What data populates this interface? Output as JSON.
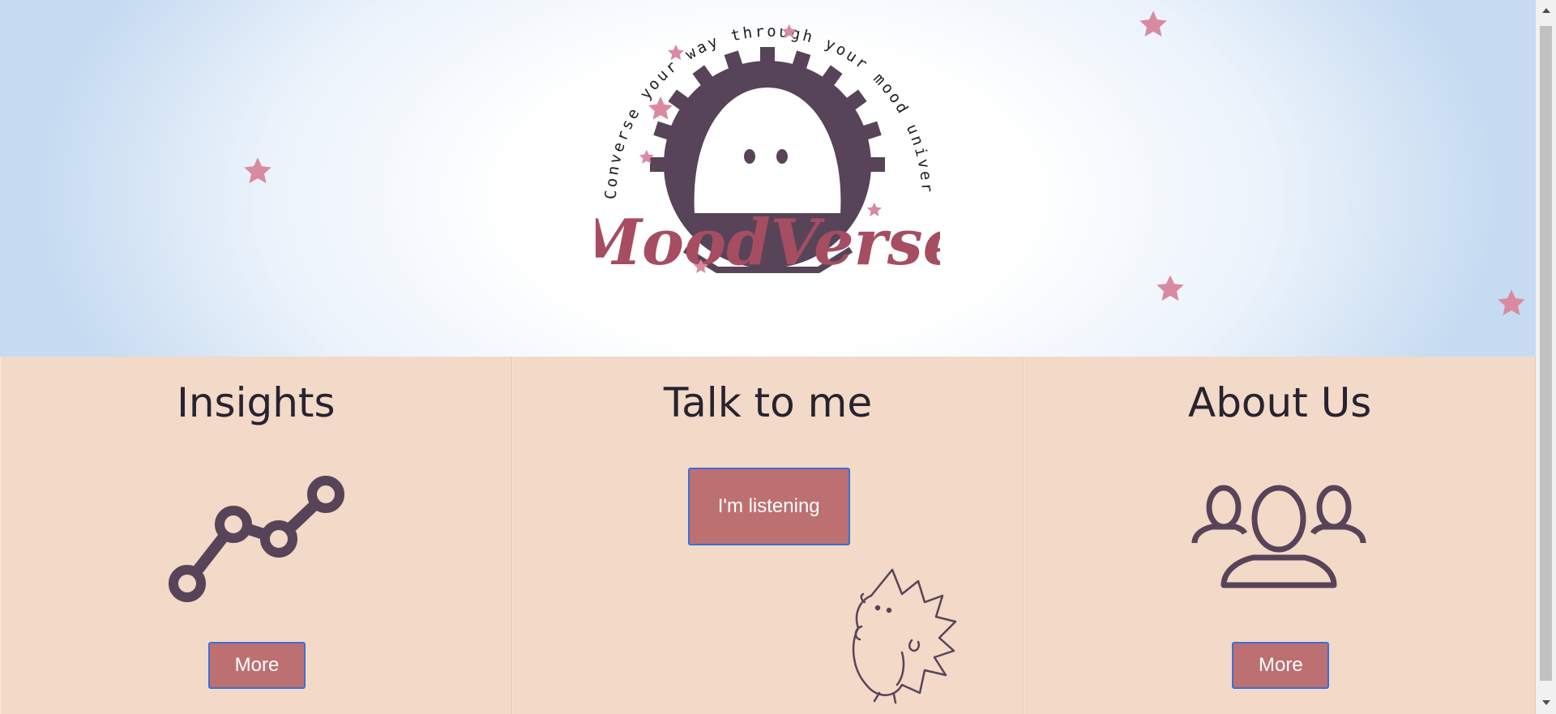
{
  "hero": {
    "tagline": "Converse your way through your mood universe.",
    "brand": "MoodVerse"
  },
  "panels": [
    {
      "title": "Insights",
      "icon": "line-chart-icon",
      "button": "More"
    },
    {
      "title": "Talk to me",
      "icon": "hedgehog-illustration",
      "button": "I'm listening"
    },
    {
      "title": "About Us",
      "icon": "group-users-icon",
      "button": "More"
    }
  ],
  "colors": {
    "panel_bg": "#f2d9c8",
    "button_bg": "#bd7072",
    "button_border": "#3b6fd4",
    "icon": "#574459",
    "star": "#d98aa0",
    "brand": "#a64d62"
  }
}
